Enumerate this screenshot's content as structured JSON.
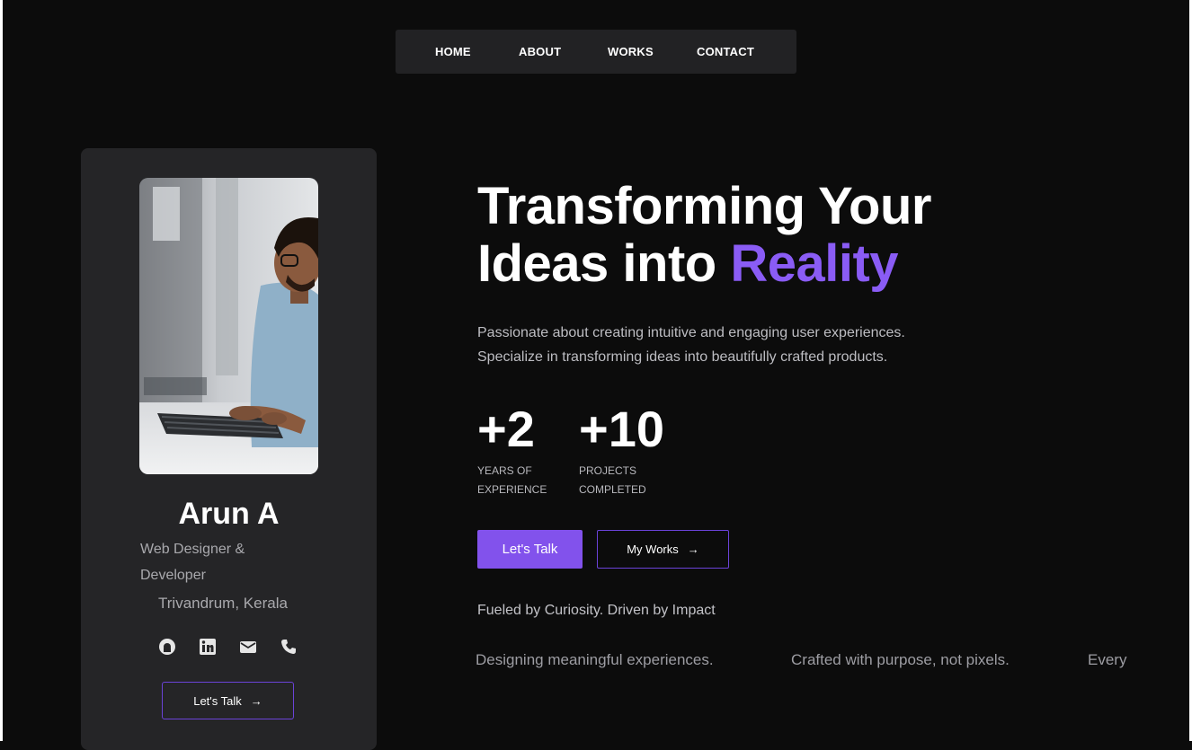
{
  "nav": {
    "items": [
      {
        "label": "HOME"
      },
      {
        "label": "ABOUT"
      },
      {
        "label": "WORKS"
      },
      {
        "label": "CONTACT"
      }
    ]
  },
  "profile": {
    "name": "Arun A",
    "role": "Web Designer & Developer",
    "location": "Trivandrum, Kerala",
    "socials": [
      "github-icon",
      "linkedin-icon",
      "mail-icon",
      "phone-icon"
    ],
    "cta_label": "Let's Talk",
    "cta_arrow": "→"
  },
  "hero": {
    "headline_line1": "Transforming Your",
    "headline_line2_prefix": "Ideas into ",
    "headline_accent": "Reality",
    "description_line1": "Passionate about creating intuitive and engaging user experiences.",
    "description_line2": "Specialize in transforming ideas into beautifully crafted products."
  },
  "stats": [
    {
      "value": "+2",
      "label_line1": "YEARS OF",
      "label_line2": "EXPERIENCE"
    },
    {
      "value": "+10",
      "label_line1": "PROJECTS",
      "label_line2": "COMPLETED"
    }
  ],
  "actions": {
    "primary_label": "Let's Talk",
    "secondary_label": "My Works",
    "secondary_arrow": "→"
  },
  "tagline": "Fueled by Curiosity. Driven by Impact",
  "marquee": [
    "Designing meaningful experiences.",
    "Crafted with purpose, not pixels.",
    "Every"
  ],
  "colors": {
    "accent": "#8252ec",
    "accent_text": "#8a5cf5",
    "background": "#0c0c0c",
    "card": "#252527",
    "nav": "#222224"
  }
}
